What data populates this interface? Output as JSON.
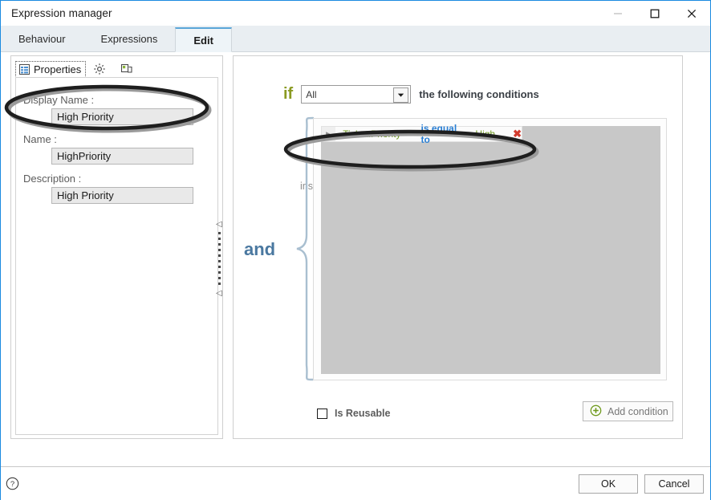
{
  "window": {
    "title": "Expression manager",
    "controls": {
      "minimize": "minimize-icon",
      "maximize": "maximize-icon",
      "close": "close-icon"
    }
  },
  "tabs": [
    {
      "label": "Behaviour",
      "active": false
    },
    {
      "label": "Expressions",
      "active": false
    },
    {
      "label": "Edit",
      "active": true
    }
  ],
  "properties_panel": {
    "tab_label": "Properties",
    "tab_icon": "grid-icon",
    "gear_icon": "gear-icon",
    "duplicate_icon": "duplicate-icon",
    "fields": [
      {
        "label": "Display Name :",
        "value": "High Priority"
      },
      {
        "label": "Name :",
        "value": "HighPriority"
      },
      {
        "label": "Description :",
        "value": "High Priority"
      }
    ]
  },
  "splitter": {
    "arrow_glyph": "◁"
  },
  "conditions_panel": {
    "if_word": "if",
    "match_mode": "All",
    "following_text": "the following conditions",
    "hint": "insert in this field all the    conditions  that you need",
    "group_operator": "and",
    "rows": [
      {
        "expander": "▶",
        "field": "Ticket.Priority",
        "operator": "is equal to",
        "value": "High",
        "delete_glyph": "✖"
      }
    ],
    "is_reusable": {
      "label": "Is Reusable",
      "checked": false
    },
    "add_condition": {
      "label": "Add condition",
      "icon": "plus-circle-icon"
    }
  },
  "footer": {
    "help_icon": "help-icon",
    "ok_label": "OK",
    "cancel_label": "Cancel"
  },
  "colors": {
    "window_border": "#1b8ae0",
    "tab_active_accent": "#5aa6d8",
    "if_keyword": "#8a9a22",
    "operator": "#2a7fd4",
    "field_value": "#6f9a1e",
    "delete": "#d23b2e",
    "and_label": "#4a78a0",
    "annotation": "#1e1e1e"
  }
}
